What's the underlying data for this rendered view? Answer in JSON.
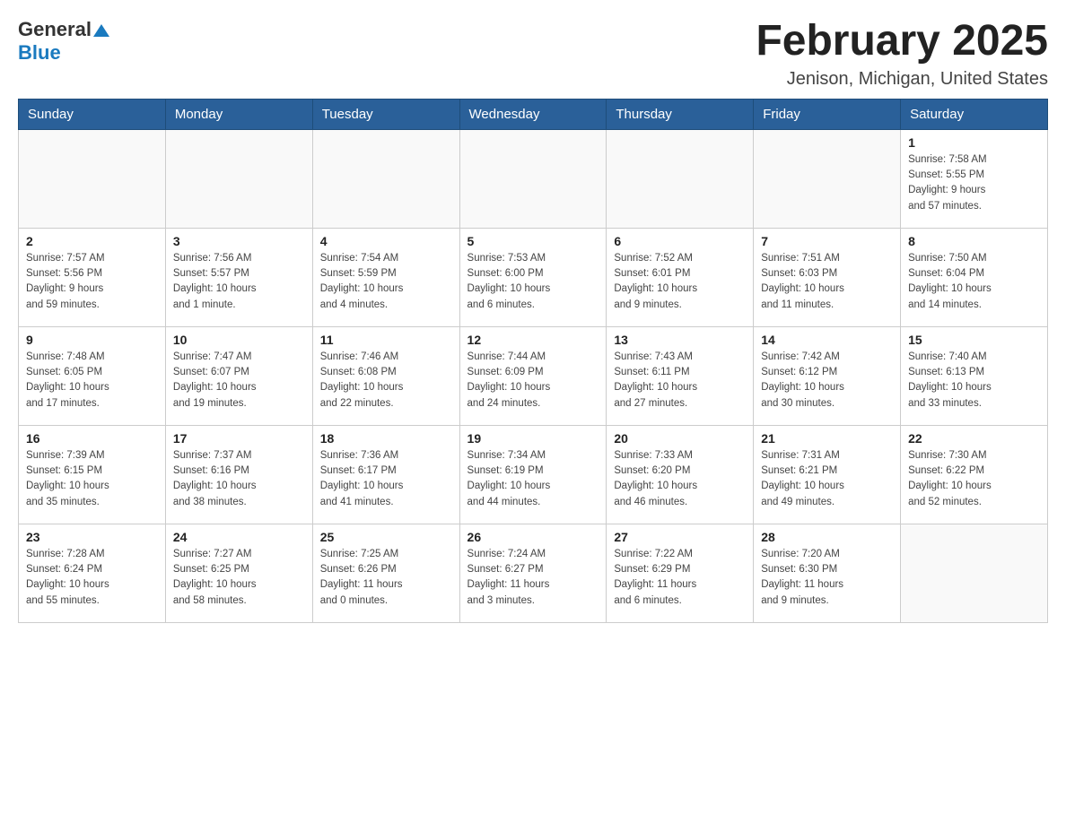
{
  "header": {
    "logo": {
      "general": "General",
      "blue": "Blue"
    },
    "title": "February 2025",
    "location": "Jenison, Michigan, United States"
  },
  "days_of_week": [
    "Sunday",
    "Monday",
    "Tuesday",
    "Wednesday",
    "Thursday",
    "Friday",
    "Saturday"
  ],
  "weeks": [
    [
      {
        "day": "",
        "info": ""
      },
      {
        "day": "",
        "info": ""
      },
      {
        "day": "",
        "info": ""
      },
      {
        "day": "",
        "info": ""
      },
      {
        "day": "",
        "info": ""
      },
      {
        "day": "",
        "info": ""
      },
      {
        "day": "1",
        "info": "Sunrise: 7:58 AM\nSunset: 5:55 PM\nDaylight: 9 hours\nand 57 minutes."
      }
    ],
    [
      {
        "day": "2",
        "info": "Sunrise: 7:57 AM\nSunset: 5:56 PM\nDaylight: 9 hours\nand 59 minutes."
      },
      {
        "day": "3",
        "info": "Sunrise: 7:56 AM\nSunset: 5:57 PM\nDaylight: 10 hours\nand 1 minute."
      },
      {
        "day": "4",
        "info": "Sunrise: 7:54 AM\nSunset: 5:59 PM\nDaylight: 10 hours\nand 4 minutes."
      },
      {
        "day": "5",
        "info": "Sunrise: 7:53 AM\nSunset: 6:00 PM\nDaylight: 10 hours\nand 6 minutes."
      },
      {
        "day": "6",
        "info": "Sunrise: 7:52 AM\nSunset: 6:01 PM\nDaylight: 10 hours\nand 9 minutes."
      },
      {
        "day": "7",
        "info": "Sunrise: 7:51 AM\nSunset: 6:03 PM\nDaylight: 10 hours\nand 11 minutes."
      },
      {
        "day": "8",
        "info": "Sunrise: 7:50 AM\nSunset: 6:04 PM\nDaylight: 10 hours\nand 14 minutes."
      }
    ],
    [
      {
        "day": "9",
        "info": "Sunrise: 7:48 AM\nSunset: 6:05 PM\nDaylight: 10 hours\nand 17 minutes."
      },
      {
        "day": "10",
        "info": "Sunrise: 7:47 AM\nSunset: 6:07 PM\nDaylight: 10 hours\nand 19 minutes."
      },
      {
        "day": "11",
        "info": "Sunrise: 7:46 AM\nSunset: 6:08 PM\nDaylight: 10 hours\nand 22 minutes."
      },
      {
        "day": "12",
        "info": "Sunrise: 7:44 AM\nSunset: 6:09 PM\nDaylight: 10 hours\nand 24 minutes."
      },
      {
        "day": "13",
        "info": "Sunrise: 7:43 AM\nSunset: 6:11 PM\nDaylight: 10 hours\nand 27 minutes."
      },
      {
        "day": "14",
        "info": "Sunrise: 7:42 AM\nSunset: 6:12 PM\nDaylight: 10 hours\nand 30 minutes."
      },
      {
        "day": "15",
        "info": "Sunrise: 7:40 AM\nSunset: 6:13 PM\nDaylight: 10 hours\nand 33 minutes."
      }
    ],
    [
      {
        "day": "16",
        "info": "Sunrise: 7:39 AM\nSunset: 6:15 PM\nDaylight: 10 hours\nand 35 minutes."
      },
      {
        "day": "17",
        "info": "Sunrise: 7:37 AM\nSunset: 6:16 PM\nDaylight: 10 hours\nand 38 minutes."
      },
      {
        "day": "18",
        "info": "Sunrise: 7:36 AM\nSunset: 6:17 PM\nDaylight: 10 hours\nand 41 minutes."
      },
      {
        "day": "19",
        "info": "Sunrise: 7:34 AM\nSunset: 6:19 PM\nDaylight: 10 hours\nand 44 minutes."
      },
      {
        "day": "20",
        "info": "Sunrise: 7:33 AM\nSunset: 6:20 PM\nDaylight: 10 hours\nand 46 minutes."
      },
      {
        "day": "21",
        "info": "Sunrise: 7:31 AM\nSunset: 6:21 PM\nDaylight: 10 hours\nand 49 minutes."
      },
      {
        "day": "22",
        "info": "Sunrise: 7:30 AM\nSunset: 6:22 PM\nDaylight: 10 hours\nand 52 minutes."
      }
    ],
    [
      {
        "day": "23",
        "info": "Sunrise: 7:28 AM\nSunset: 6:24 PM\nDaylight: 10 hours\nand 55 minutes."
      },
      {
        "day": "24",
        "info": "Sunrise: 7:27 AM\nSunset: 6:25 PM\nDaylight: 10 hours\nand 58 minutes."
      },
      {
        "day": "25",
        "info": "Sunrise: 7:25 AM\nSunset: 6:26 PM\nDaylight: 11 hours\nand 0 minutes."
      },
      {
        "day": "26",
        "info": "Sunrise: 7:24 AM\nSunset: 6:27 PM\nDaylight: 11 hours\nand 3 minutes."
      },
      {
        "day": "27",
        "info": "Sunrise: 7:22 AM\nSunset: 6:29 PM\nDaylight: 11 hours\nand 6 minutes."
      },
      {
        "day": "28",
        "info": "Sunrise: 7:20 AM\nSunset: 6:30 PM\nDaylight: 11 hours\nand 9 minutes."
      },
      {
        "day": "",
        "info": ""
      }
    ]
  ]
}
